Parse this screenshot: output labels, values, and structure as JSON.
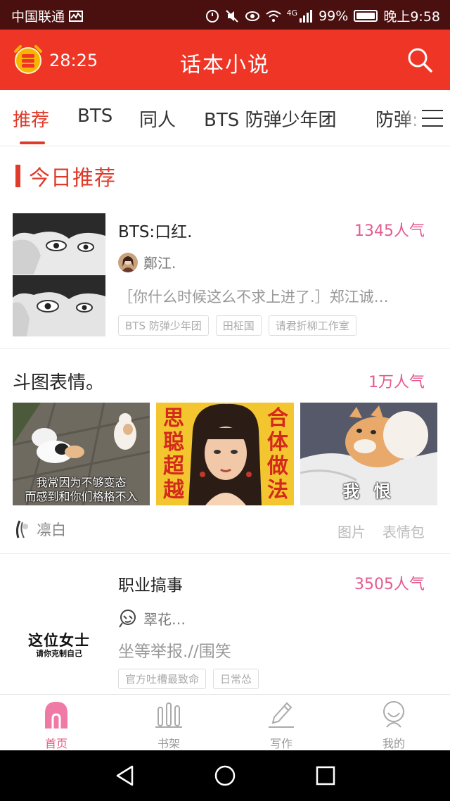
{
  "status_bar": {
    "carrier": "中国联通",
    "network": "4G",
    "battery": "99%",
    "battery_level": 0.99,
    "time": "晚上9:58"
  },
  "header": {
    "timer": "28:25",
    "title": "话本小说",
    "alarm_icon": "alarm-clock-icon",
    "search_icon": "search-icon",
    "bg_color": "#ee3526"
  },
  "tabs": [
    {
      "label": "推荐",
      "active": true
    },
    {
      "label": "BTS"
    },
    {
      "label": "同人"
    },
    {
      "label": "BTS  防弹少年团"
    },
    {
      "label": "防弹:"
    }
  ],
  "section": {
    "title": "今日推荐"
  },
  "card1": {
    "title": "BTS:口红.",
    "popularity": "1345人气",
    "author": "鄭江.",
    "description": "［你什么时候这么不求上进了.］郑江诚…",
    "tags": [
      "BTS  防弹少年团",
      "田柾国",
      "请君折柳工作室"
    ]
  },
  "card2": {
    "title": "斗图表情。",
    "popularity": "1万人气",
    "author": "凛白",
    "categories": [
      "图片",
      "表情包"
    ],
    "images": [
      {
        "caption_line1": "我常因为不够变态",
        "caption_line2": "而感到和你们格格不入"
      },
      {
        "left_text": "思聪超越",
        "right_text": "合体做法"
      },
      {
        "caption": "我 恨"
      }
    ]
  },
  "card3": {
    "title": "职业搞事",
    "popularity": "3505人气",
    "author": "翠花…",
    "description": "坐等举报.//围笑",
    "tags": [
      "官方吐槽最致命",
      "日常怂"
    ],
    "cover_title": "这位女士",
    "cover_subtitle": "请你克制自己"
  },
  "bottom_nav": [
    {
      "label": "首页",
      "icon": "home-icon",
      "active": true
    },
    {
      "label": "书架",
      "icon": "bookshelf-icon"
    },
    {
      "label": "写作",
      "icon": "pen-icon"
    },
    {
      "label": "我的",
      "icon": "profile-icon"
    }
  ],
  "colors": {
    "accent": "#e03a2a",
    "popularity": "#e45b8f",
    "nav_active": "#e85a86"
  }
}
